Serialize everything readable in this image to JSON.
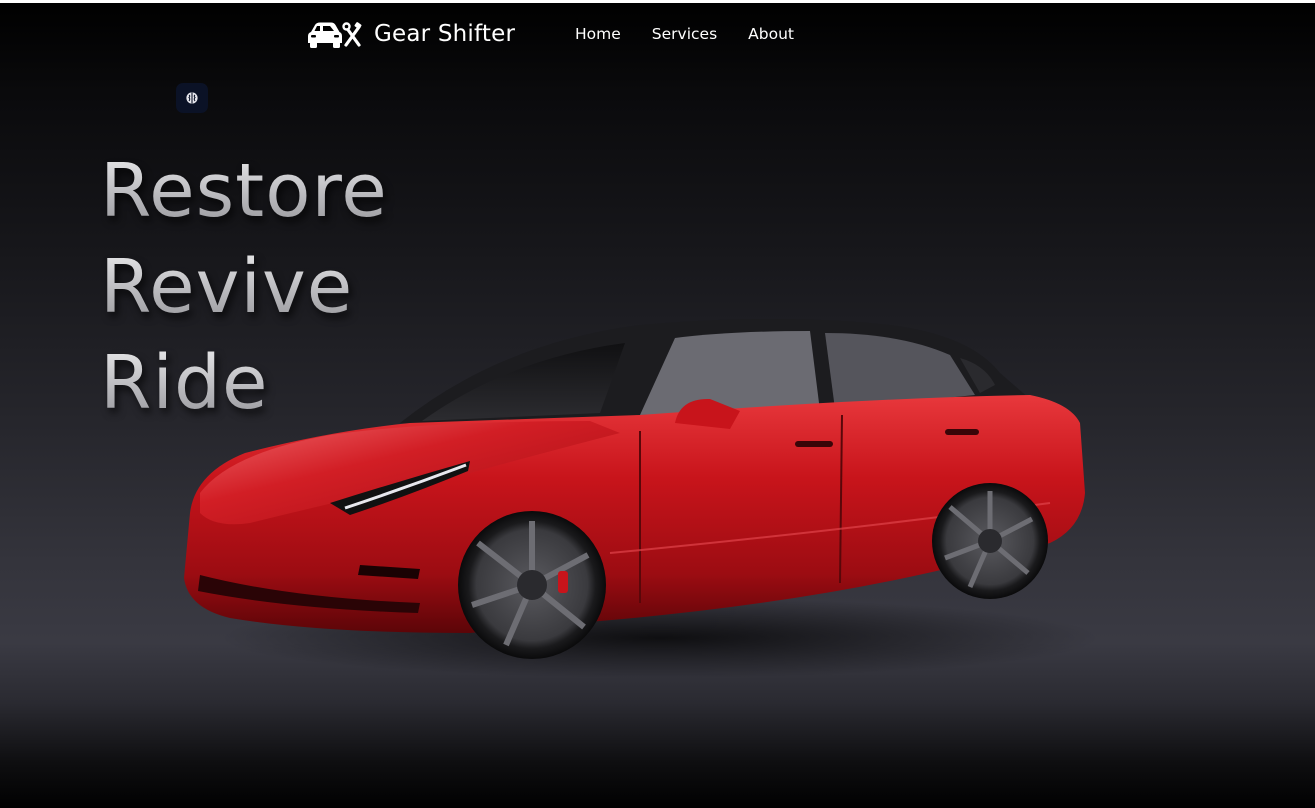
{
  "brand": {
    "name": "Gear Shifter",
    "icon": "car-with-tools-icon"
  },
  "nav": {
    "items": [
      {
        "label": "Home"
      },
      {
        "label": "Services"
      },
      {
        "label": "About"
      }
    ]
  },
  "chip": {
    "icon": "brain-icon"
  },
  "hero": {
    "lines": [
      "Restore",
      "Revive",
      "Ride"
    ]
  },
  "car": {
    "color": "#c8141b",
    "description_icon": "red-sedan-image"
  },
  "colors": {
    "background_top": "#000000",
    "background_mid": "#3a3a43",
    "text": "#ffffff",
    "chip": "#0b1226"
  }
}
